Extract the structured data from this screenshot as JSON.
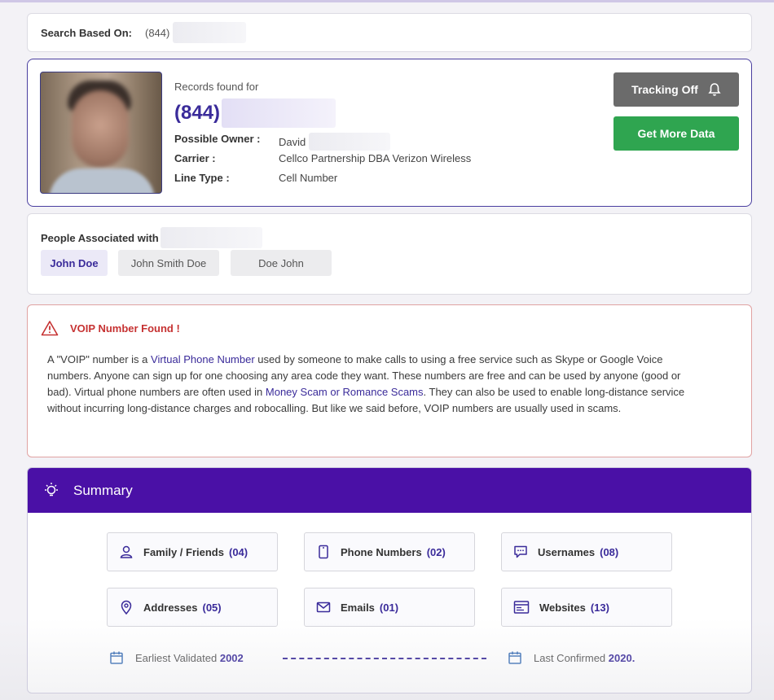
{
  "search": {
    "label": "Search Based On:",
    "value": "(844)"
  },
  "record": {
    "records_label": "Records found for",
    "phone": "(844)",
    "owner_label": "Possible Owner :",
    "owner_value": "David",
    "carrier_label": "Carrier :",
    "carrier_value": "Cellco Partnership DBA Verizon Wireless",
    "line_type_label": "Line Type :",
    "line_type_value": "Cell Number",
    "tracking_button": "Tracking Off",
    "more_data_button": "Get More Data"
  },
  "people": {
    "title": "People Associated with",
    "chips": [
      "John Doe",
      "John Smith Doe",
      "Doe John"
    ]
  },
  "voip": {
    "title": "VOIP Number Found !",
    "p1": "A \"VOIP\" number is a ",
    "link1": "Virtual Phone Number",
    "p2": " used by someone to make calls to using a free service such as Skype or Google Voice numbers. Anyone can sign up for one choosing any area code they want. These numbers are free and can be used by anyone (good or bad). Virtual phone numbers are often used in ",
    "link2": "Money Scam or Romance Scams",
    "p3": ". They can also be used to enable long-distance service without incurring long-distance charges and robocalling. But like we said before, VOIP numbers are usually used in scams."
  },
  "summary": {
    "title": "Summary",
    "tiles": [
      {
        "label": "Family / Friends",
        "count": "(04)",
        "icon": "user-icon"
      },
      {
        "label": "Phone Numbers",
        "count": "(02)",
        "icon": "phone-icon"
      },
      {
        "label": "Usernames",
        "count": "(08)",
        "icon": "chat-icon"
      },
      {
        "label": "Addresses",
        "count": "(05)",
        "icon": "location-pin-icon"
      },
      {
        "label": "Emails",
        "count": "(01)",
        "icon": "envelope-icon"
      },
      {
        "label": "Websites",
        "count": "(13)",
        "icon": "browser-icon"
      }
    ],
    "earliest_label": "Earliest Validated",
    "earliest_year": "2002",
    "last_label": "Last Confirmed",
    "last_year": "2020."
  },
  "colors": {
    "accent": "#4a10a6",
    "link": "#3a2b9a",
    "success": "#2fa550",
    "danger": "#c63232"
  }
}
